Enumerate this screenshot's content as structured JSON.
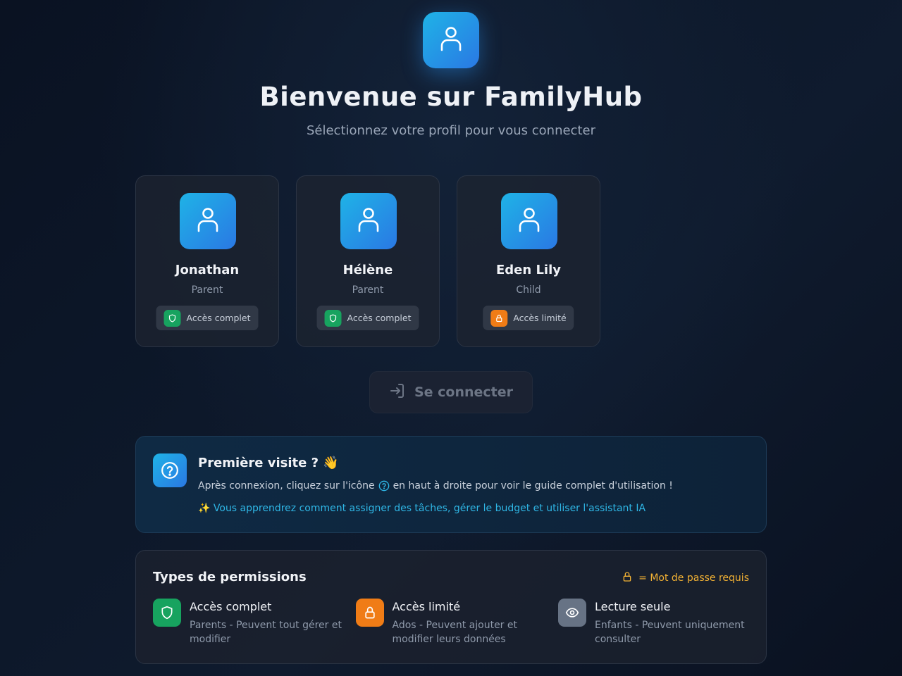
{
  "header": {
    "logo_icon": "user-icon",
    "title": "Bienvenue sur FamilyHub",
    "subtitle": "Sélectionnez votre profil pour vous connecter"
  },
  "profiles": [
    {
      "name": "Jonathan",
      "role": "Parent",
      "access": "Accès complet",
      "access_icon": "shield-icon",
      "access_color": "#17a35f"
    },
    {
      "name": "Hélène",
      "role": "Parent",
      "access": "Accès complet",
      "access_icon": "shield-icon",
      "access_color": "#17a35f"
    },
    {
      "name": "Eden Lily",
      "role": "Child",
      "access": "Accès limité",
      "access_icon": "lock-icon",
      "access_color": "#f07c16"
    }
  ],
  "connect_button": {
    "label": "Se connecter",
    "icon": "login-icon",
    "disabled": true
  },
  "first_visit": {
    "title": "Première visite ? 👋",
    "text_before": "Après connexion, cliquez sur l'icône",
    "text_after": "en haut à droite pour voir le guide complet d'utilisation !",
    "tip": "✨ Vous apprendrez comment assigner des tâches, gérer le budget et utiliser l'assistant IA",
    "icon": "help-circle-icon"
  },
  "permissions": {
    "title": "Types de permissions",
    "note": "= Mot de passe requis",
    "items": [
      {
        "name": "Accès complet",
        "desc": "Parents - Peuvent tout gérer et modifier",
        "icon": "shield-icon",
        "color": "#17a35f"
      },
      {
        "name": "Accès limité",
        "desc": "Ados - Peuvent ajouter et modifier leurs données",
        "icon": "lock-icon",
        "color": "#f07c16"
      },
      {
        "name": "Lecture seule",
        "desc": "Enfants - Peuvent uniquement consulter",
        "icon": "eye-icon",
        "color": "#677385"
      }
    ]
  },
  "colors": {
    "accent": "#1fb3e6",
    "accent_dark": "#2a78e4",
    "success": "#17a35f",
    "warning": "#f07c16",
    "note": "#f3b234"
  }
}
